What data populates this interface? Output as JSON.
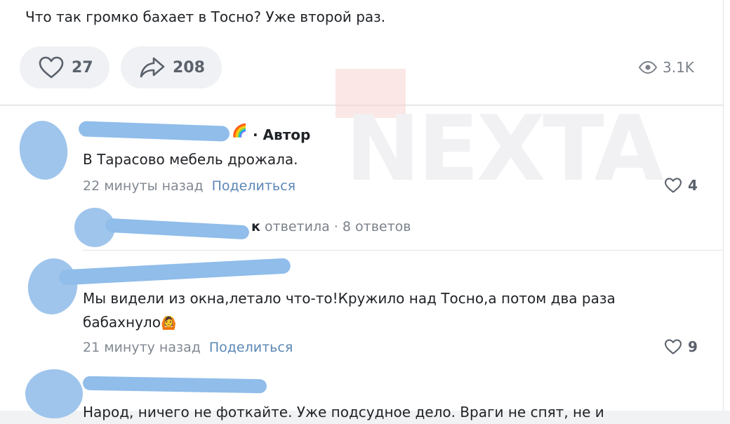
{
  "post": {
    "text": "Что так громко бахает в Тосно? Уже второй раз.",
    "likes": "27",
    "shares": "208",
    "views": "3.1K"
  },
  "watermark": {
    "text": "NEXTA"
  },
  "comments": [
    {
      "author_badge": "· Автор",
      "text": "В Тарасово мебель дрожала.",
      "time": "22 минуты назад",
      "share_label": "Поделиться",
      "likes": "4"
    },
    {
      "text_line1": "Мы видели из окна,летало что-то!Кружило над Тосно,а потом два раза",
      "text_line2": "бабахнуло",
      "time": "21 минуту назад",
      "share_label": "Поделиться",
      "likes": "9"
    },
    {
      "text": "Народ, ничего не фоткайте. Уже подсудное дело. Враги не спят, не и"
    }
  ],
  "reply_thread": {
    "author_tail": "к",
    "action": "ответила",
    "count": "· 8 ответов"
  },
  "colors": {
    "link": "#5b87b5",
    "blur": "#9fc5ec"
  }
}
